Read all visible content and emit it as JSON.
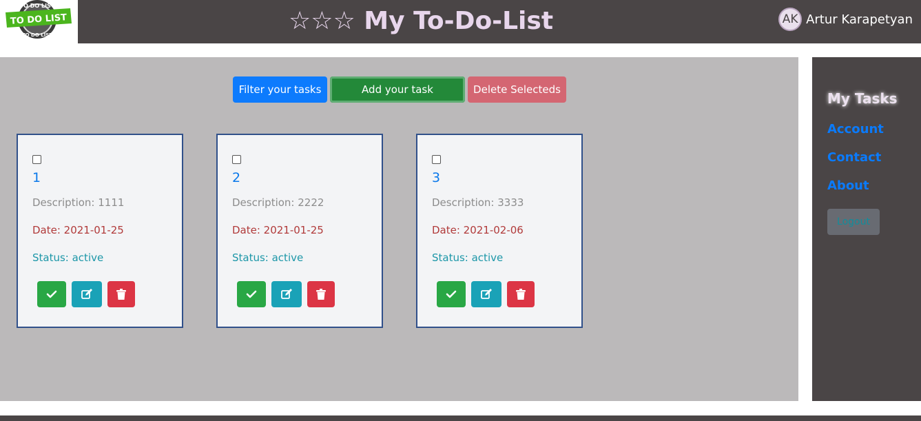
{
  "header": {
    "title": "☆☆☆ My To-Do-List",
    "logo_alt": "TO DO LIST",
    "user": {
      "initials": "AK",
      "name": "Artur Karapetyan"
    }
  },
  "toolbar": {
    "filter_label": "Filter your tasks",
    "add_label": "Add your task",
    "delete_label": "Delete Selecteds"
  },
  "tasks": [
    {
      "title": "1",
      "description": "Description: 1111",
      "date": "Date: 2021-01-25",
      "status": "Status: active"
    },
    {
      "title": "2",
      "description": "Description: 2222",
      "date": "Date: 2021-01-25",
      "status": "Status: active"
    },
    {
      "title": "3",
      "description": "Description: 3333",
      "date": "Date: 2021-02-06",
      "status": "Status: active"
    }
  ],
  "sidebar": {
    "items": [
      {
        "label": "My Tasks",
        "active": true
      },
      {
        "label": "Account"
      },
      {
        "label": "Contact"
      },
      {
        "label": "About"
      }
    ],
    "logout_label": "Logout"
  },
  "icons": {
    "done": "check-icon",
    "edit": "edit-icon",
    "delete": "trash-icon"
  },
  "colors": {
    "header_bg": "#4a4546",
    "main_bg": "#bbb9ba",
    "primary": "#0d7bfd",
    "success": "#238939",
    "danger": "#dc3545",
    "info": "#1aa2b7"
  }
}
